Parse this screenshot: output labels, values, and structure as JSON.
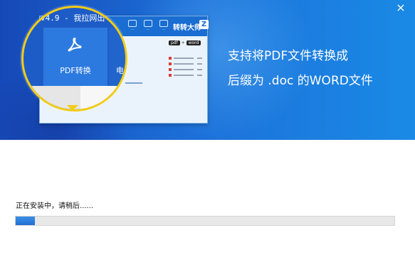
{
  "banner": {
    "close_glyph": "×",
    "magnifier": {
      "title": "V4.9 - 我拉网出",
      "pdf_tab_label": "PDF转换",
      "next_tab_partial": "电",
      "pdf_icon": "acrobat-icon"
    },
    "mini_app": {
      "brand": "转转大师",
      "logo_letter": "Z",
      "convert_from": "pdf",
      "convert_to": "word"
    },
    "promo_line1": "支持将PDF文件转换成",
    "promo_line2": "后缀为 .doc 的WORD文件",
    "colors": {
      "gradient_start": "#1649b7",
      "gradient_end": "#1a8ae6",
      "magnifier_ring": "#f3cc15"
    }
  },
  "install": {
    "status_text": "正在安装中，请稍后......",
    "progress_fraction": 0.05,
    "progress_color": "#1f6fd4"
  }
}
